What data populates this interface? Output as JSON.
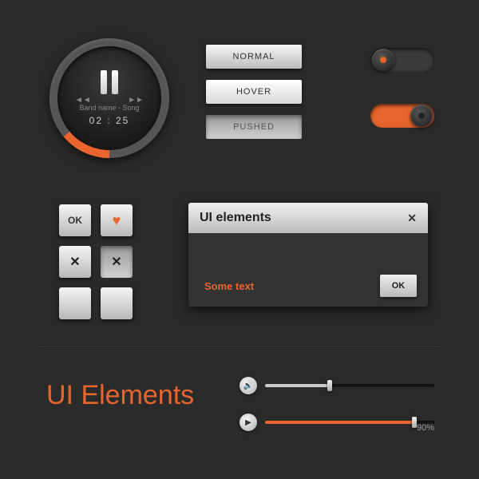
{
  "player": {
    "track_label": "Band name - Song",
    "time": "02 : 25"
  },
  "state_buttons": {
    "normal": "NORMAL",
    "hover": "HOVER",
    "pushed": "PUSHED"
  },
  "toggles": {
    "off_state": "off",
    "on_state": "on"
  },
  "small_buttons": {
    "ok": "OK",
    "heart": "♥",
    "x": "✕"
  },
  "dialog": {
    "title": "UI elements",
    "close": "✕",
    "body_text": "Some text",
    "ok": "OK"
  },
  "title": "UI Elements",
  "sliders": {
    "volume_pct": 38,
    "progress_pct": 88,
    "progress_label": "90%"
  },
  "colors": {
    "accent": "#e8652e",
    "bg": "#2a2a2a"
  }
}
